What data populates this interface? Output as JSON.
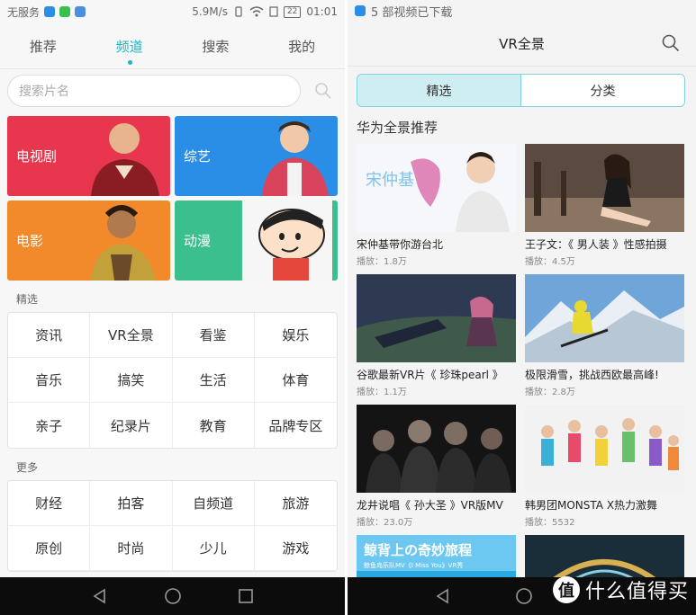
{
  "left": {
    "status": {
      "carrier": "无服务",
      "speed": "5.9M/s",
      "battery": "22",
      "time": "01:01"
    },
    "tabs": [
      {
        "label": "推荐"
      },
      {
        "label": "频道"
      },
      {
        "label": "搜索"
      },
      {
        "label": "我的"
      }
    ],
    "search": {
      "placeholder": "搜索片名"
    },
    "tiles": [
      {
        "label": "电视剧",
        "color": "#e8364f"
      },
      {
        "label": "综艺",
        "color": "#2a8de6"
      },
      {
        "label": "电影",
        "color": "#f28a2c"
      },
      {
        "label": "动漫",
        "color": "#3cbf8f"
      }
    ],
    "featured_label": "精选",
    "featured": [
      "资讯",
      "VR全景",
      "看鉴",
      "娱乐",
      "音乐",
      "搞笑",
      "生活",
      "体育",
      "亲子",
      "纪录片",
      "教育",
      "品牌专区"
    ],
    "more_label": "更多",
    "more": [
      "财经",
      "拍客",
      "自频道",
      "旅游",
      "原创",
      "时尚",
      "少儿",
      "游戏"
    ]
  },
  "right": {
    "notification": "5 部视频已下载",
    "title": "VR全景",
    "segments": [
      {
        "label": "精选"
      },
      {
        "label": "分类"
      }
    ],
    "section_title": "华为全景推荐",
    "videos": [
      {
        "title": "宋仲基带你游台北",
        "plays": "播放：1.8万",
        "thumb_text": "宋仲基"
      },
      {
        "title": "王子文：《 男人装 》性感拍摄",
        "plays": "播放：4.5万"
      },
      {
        "title": "谷歌最新VR片《 珍珠pearl 》",
        "plays": "播放：1.1万"
      },
      {
        "title": "极限滑雪，挑战西欧最高峰!",
        "plays": "播放：2.8万"
      },
      {
        "title": "龙井说唱《 孙大圣 》VR版MV",
        "plays": "播放：23.0万"
      },
      {
        "title": "韩男团MONSTA X热力激舞",
        "plays": "播放：5532"
      },
      {
        "title": "",
        "plays": "",
        "thumb_text": "鲸背上の奇妙旅程",
        "thumb_subtext": "鲸鱼岛乐队MV《I Miss You》VR秀"
      },
      {
        "title": "",
        "plays": ""
      }
    ]
  },
  "watermark": {
    "text": "什么值得买",
    "badge": "值"
  },
  "colors": {
    "accent": "#1bb7c8",
    "navbar": "#0c0c0c"
  }
}
